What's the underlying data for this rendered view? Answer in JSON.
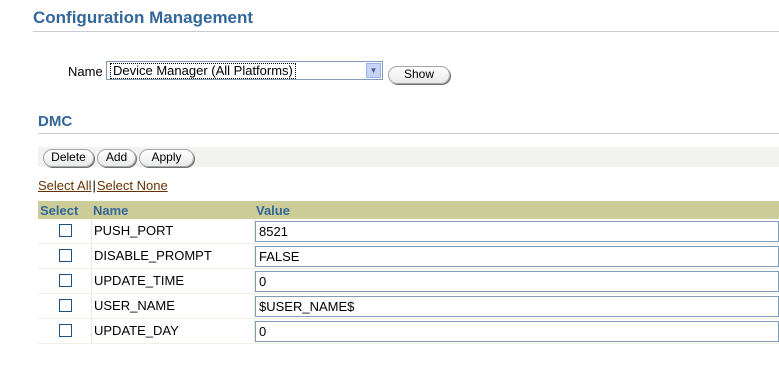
{
  "page": {
    "title": "Configuration Management"
  },
  "filter": {
    "name_label": "Name",
    "selected": "Device Manager (All Platforms)",
    "show_label": "Show"
  },
  "section": {
    "title": "DMC",
    "actions": {
      "delete": "Delete",
      "add": "Add",
      "apply": "Apply"
    },
    "select_all": "Select All",
    "separator": "|",
    "select_none": "Select None"
  },
  "table": {
    "headers": {
      "select": "Select",
      "name": "Name",
      "value": "Value"
    },
    "rows": [
      {
        "name": "PUSH_PORT",
        "value": "8521"
      },
      {
        "name": "DISABLE_PROMPT",
        "value": "FALSE"
      },
      {
        "name": "UPDATE_TIME",
        "value": "0"
      },
      {
        "name": "USER_NAME",
        "value": "$USER_NAME$"
      },
      {
        "name": "UPDATE_DAY",
        "value": "0"
      }
    ]
  },
  "colors": {
    "title": "#336699",
    "header_bg": "#cccc99",
    "link": "#663300"
  },
  "icons": {
    "dropdown": "chevron-down-icon",
    "checkbox": "checkbox-icon"
  }
}
